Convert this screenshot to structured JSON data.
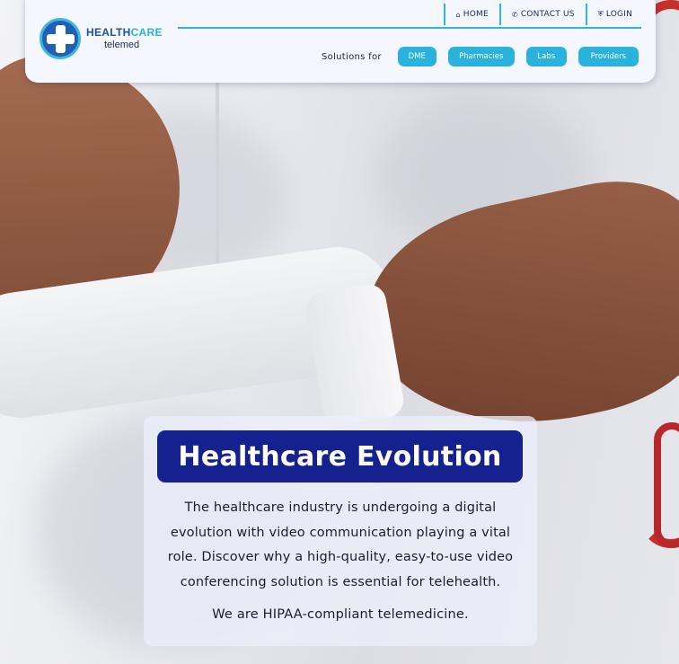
{
  "brand": {
    "name_part1": "HEALTH",
    "name_part2": "CARE",
    "tagline": "telemed"
  },
  "topnav": [
    {
      "label": "HOME",
      "icon": "home-icon"
    },
    {
      "label": "CONTACT US",
      "icon": "phone-icon"
    },
    {
      "label": "LOGIN",
      "icon": "shield-icon"
    }
  ],
  "solutions": {
    "label": "Solutions for",
    "buttons": [
      "DME",
      "Pharmacies",
      "Labs",
      "Providers"
    ]
  },
  "hero": {
    "title": "Healthcare Evolution",
    "body": "The healthcare industry is undergoing a digital evolution with video communication playing a vital role. Discover why a high-quality, easy-to-use video conferencing solution is essential for telehealth.",
    "note": "We are HIPAA-compliant telemedicine."
  },
  "colors": {
    "accent": "#2ab2df",
    "primary": "#14218f",
    "brand_blue": "#1f4fa8"
  }
}
